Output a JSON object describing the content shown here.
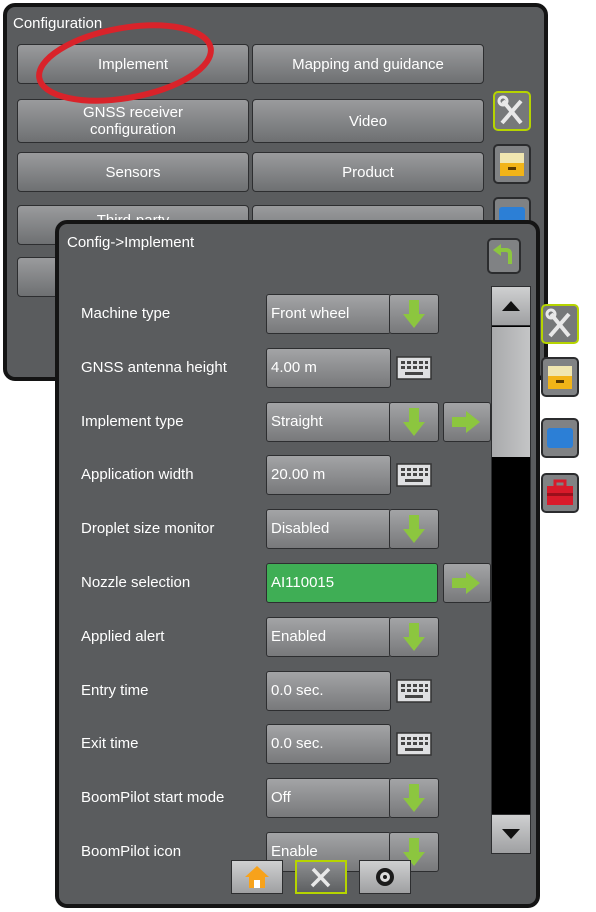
{
  "config_screen": {
    "title": "Configuration",
    "buttons": {
      "implement": "Implement",
      "mapping": "Mapping and guidance",
      "gnss": "GNSS receiver configuration",
      "video": "Video",
      "sensors": "Sensors",
      "product": "Product",
      "third_party": "Third-party"
    }
  },
  "implement_screen": {
    "title": "Config->Implement",
    "rows": [
      {
        "label": "Machine type",
        "value": "Front wheel",
        "control": "dropdown"
      },
      {
        "label": "GNSS antenna height",
        "value": "4.00 m",
        "control": "keyboard"
      },
      {
        "label": "Implement type",
        "value": "Straight",
        "control": "dropdown",
        "nav": true
      },
      {
        "label": "Application width",
        "value": "20.00 m",
        "control": "keyboard"
      },
      {
        "label": "Droplet size monitor",
        "value": "Disabled",
        "control": "dropdown"
      },
      {
        "label": "Nozzle selection",
        "value": "AI110015",
        "control": "select",
        "nav": true
      },
      {
        "label": "Applied alert",
        "value": "Enabled",
        "control": "dropdown"
      },
      {
        "label": "Entry time",
        "value": "0.0 sec.",
        "control": "keyboard"
      },
      {
        "label": "Exit time",
        "value": "0.0 sec.",
        "control": "keyboard"
      },
      {
        "label": "BoomPilot start mode",
        "value": "Off",
        "control": "dropdown"
      },
      {
        "label": "BoomPilot icon",
        "value": "Enable",
        "control": "dropdown"
      }
    ]
  },
  "icons": {
    "back": "back-arrow-icon",
    "tools": "wrench-screwdriver-icon",
    "drawer": "cabinet-drawer-icon",
    "display": "display-screen-icon",
    "toolbox": "toolbox-icon",
    "home": "home-icon",
    "camera": "camera-icon",
    "keyboard": "keyboard-icon",
    "dropdown": "down-arrow-icon",
    "nav": "right-arrow-icon"
  },
  "colors": {
    "accent": "#b6d400",
    "selected": "#3fae55",
    "arrow": "#8cc63f",
    "highlight_circle": "#d9232a"
  }
}
